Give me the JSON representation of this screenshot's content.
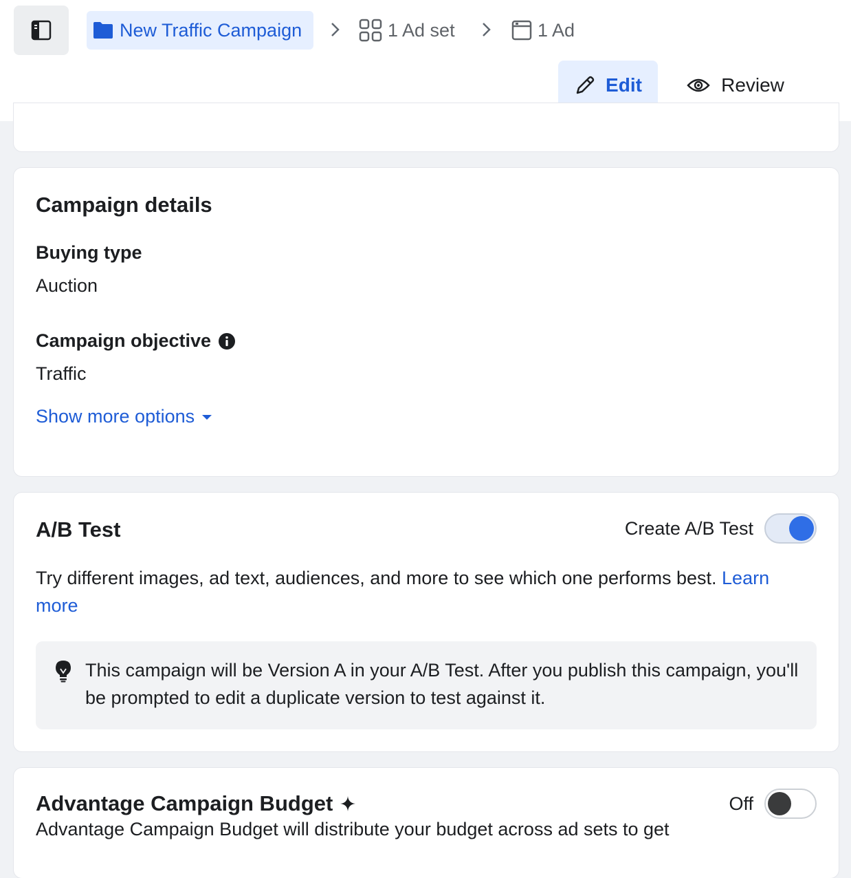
{
  "breadcrumb": {
    "campaign": "New Traffic Campaign",
    "adset": "1 Ad set",
    "ad": "1 Ad"
  },
  "mode": {
    "edit": "Edit",
    "review": "Review"
  },
  "campaign_details": {
    "title": "Campaign details",
    "buying_type_label": "Buying type",
    "buying_type_value": "Auction",
    "objective_label": "Campaign objective",
    "objective_value": "Traffic",
    "show_more": "Show more options"
  },
  "ab_test": {
    "title": "A/B Test",
    "toggle_label": "Create A/B Test",
    "toggle_on": true,
    "description": "Try different images, ad text, audiences, and more to see which one performs best.",
    "learn_more_1": "Learn",
    "learn_more_2": "more",
    "tip": "This campaign will be Version A in your A/B Test. After you publish this campaign, you'll be prompted to edit a duplicate version to test against it."
  },
  "budget": {
    "title": "Advantage Campaign Budget",
    "toggle_label": "Off",
    "toggle_on": false,
    "description": "Advantage Campaign Budget will distribute your budget across ad sets to get"
  },
  "colors": {
    "accent": "#1e5cd6",
    "toggle_on": "#2f6ee6",
    "page_bg": "#f0f2f5"
  }
}
